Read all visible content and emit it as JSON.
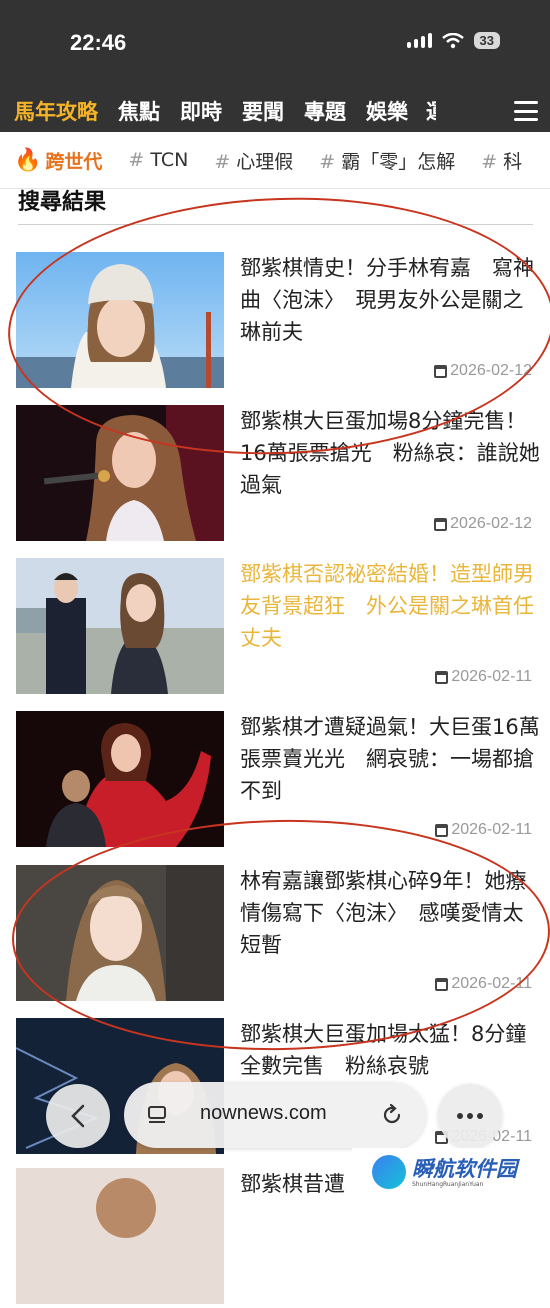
{
  "status_bar": {
    "time": "22:46",
    "battery": "33"
  },
  "nav": {
    "items": [
      "馬年攻略",
      "焦點",
      "即時",
      "要聞",
      "專題",
      "娛樂",
      "運"
    ]
  },
  "tags": {
    "items": [
      "跨世代",
      "TCN",
      "心理假",
      "霸「零」怎解",
      "科"
    ]
  },
  "section_title": "搜尋結果",
  "articles": [
    {
      "headline": "鄧紫棋情史！分手林宥嘉　寫神曲〈泡沫〉　現男友外公是關之琳前夫",
      "date": "2026-02-12",
      "color": "#222222"
    },
    {
      "headline": "鄧紫棋大巨蛋加場8分鐘完售！16萬張票搶光　粉絲哀：誰說她過氣",
      "date": "2026-02-12",
      "color": "#222222"
    },
    {
      "headline": "鄧紫棋否認祕密結婚！造型師男友背景超狂　外公是關之琳首任丈夫",
      "date": "2026-02-11",
      "color": "#e9b63a"
    },
    {
      "headline": "鄧紫棋才遭疑過氣！大巨蛋16萬張票賣光光　網哀號：一場都搶不到",
      "date": "2026-02-11",
      "color": "#222222"
    },
    {
      "headline": "林宥嘉讓鄧紫棋心碎9年！她療情傷寫下〈泡沫〉　感嘆愛情太短暫",
      "date": "2026-02-11",
      "color": "#222222"
    },
    {
      "headline": "鄧紫棋大巨蛋加場太猛！8分鐘全數完售　粉絲哀號",
      "date": "2026-02-11",
      "color": "#222222"
    },
    {
      "headline": "鄧紫棋昔遭",
      "date": "",
      "color": "#222222"
    }
  ],
  "browser": {
    "url": "nownews.com"
  },
  "watermark": {
    "main": "瞬航软件园",
    "sub": "ShunHangRuanJianYuan"
  }
}
